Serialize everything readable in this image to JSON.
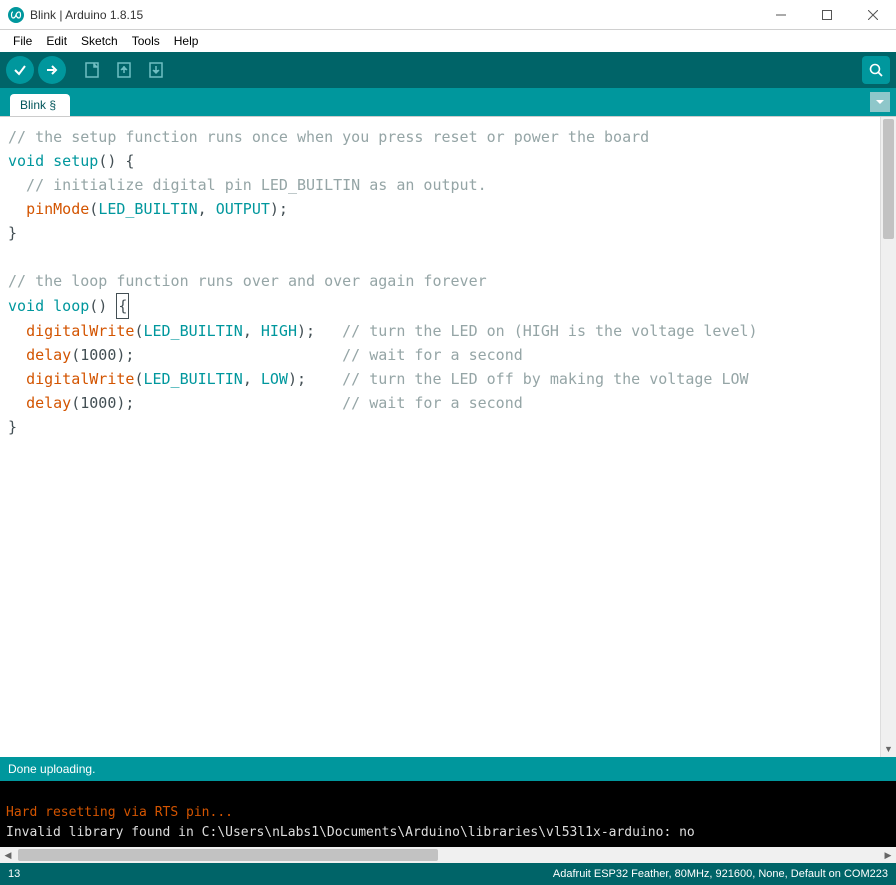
{
  "titlebar": {
    "title": "Blink | Arduino 1.8.15"
  },
  "menu": {
    "file": "File",
    "edit": "Edit",
    "sketch": "Sketch",
    "tools": "Tools",
    "help": "Help"
  },
  "tabs": {
    "active": "Blink §"
  },
  "code": {
    "l1": "// the setup function runs once when you press reset or power the board",
    "l2a": "void",
    "l2b": "setup",
    "l2c": "() {",
    "l3": "  // initialize digital pin LED_BUILTIN as an output.",
    "l4a": "pinMode",
    "l4b": "(",
    "l4c": "LED_BUILTIN",
    "l4d": ", ",
    "l4e": "OUTPUT",
    "l4f": ");",
    "l5": "}",
    "l7": "// the loop function runs over and over again forever",
    "l8a": "void",
    "l8b": "loop",
    "l8c": "() ",
    "l8d": "{",
    "l9a": "digitalWrite",
    "l9b": "(",
    "l9c": "LED_BUILTIN",
    "l9d": ", ",
    "l9e": "HIGH",
    "l9f": ");",
    "l9g": "   // turn the LED on (HIGH is the voltage level)",
    "l10a": "delay",
    "l10b": "(1000);",
    "l10c": "                       // wait for a second",
    "l11a": "digitalWrite",
    "l11b": "(",
    "l11c": "LED_BUILTIN",
    "l11d": ", ",
    "l11e": "LOW",
    "l11f": ");",
    "l11g": "    // turn the LED off by making the voltage LOW",
    "l12a": "delay",
    "l12b": "(1000);",
    "l12c": "                       // wait for a second",
    "l13": "}"
  },
  "status": {
    "message": "Done uploading."
  },
  "console": {
    "line1": "Hard resetting via RTS pin...",
    "line2": "Invalid library found in C:\\Users\\nLabs1\\Documents\\Arduino\\libraries\\vl53l1x-arduino: no"
  },
  "footer": {
    "line": "13",
    "board": "Adafruit ESP32 Feather, 80MHz, 921600, None, Default on COM223"
  }
}
